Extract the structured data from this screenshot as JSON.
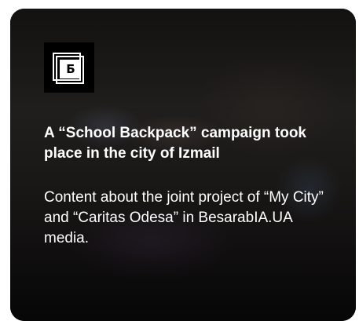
{
  "card": {
    "logo": {
      "letter": "Б",
      "icon": "besarabia-logo-icon"
    },
    "headline": "A “School Backpack” campaign took place in the city of Izmail",
    "description": "Content about the joint project of “My City” and “Caritas Odesa” in BesarabIA.UA media."
  },
  "colors": {
    "text": "#ffffff",
    "logo_background": "#000000",
    "page_background": "#ffffff"
  }
}
